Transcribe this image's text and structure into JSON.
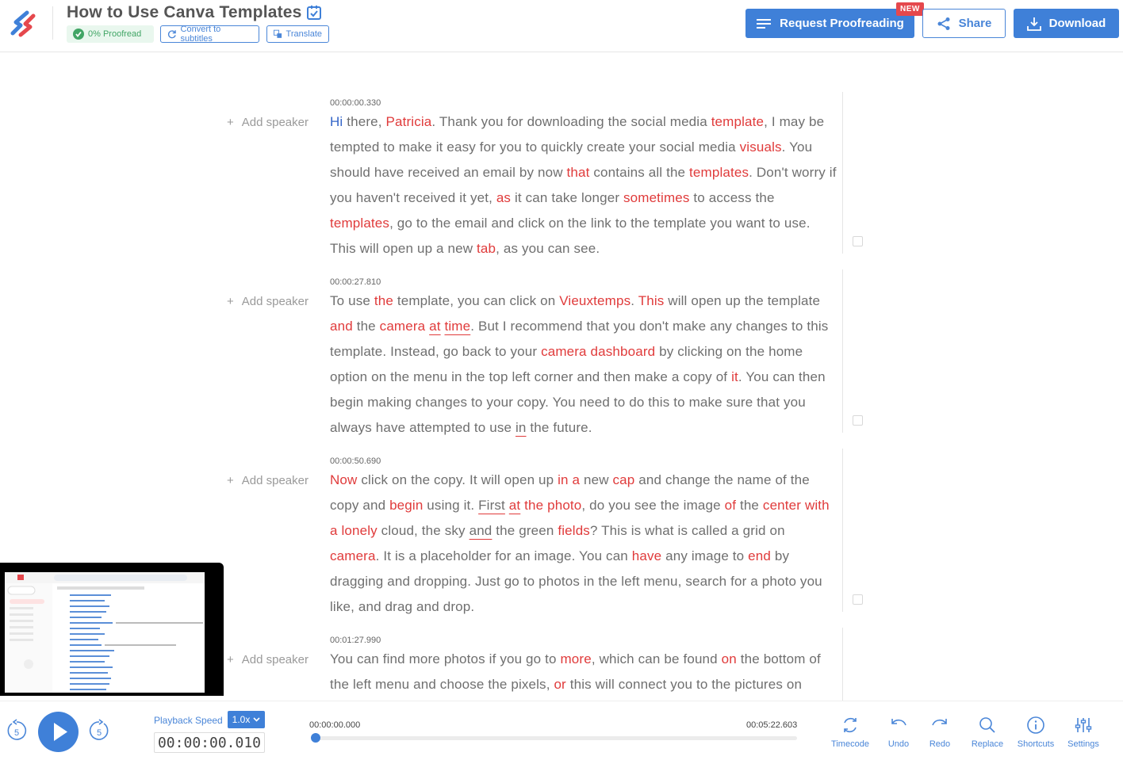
{
  "header": {
    "title": "How to Use Canva Templates",
    "proofread_label": "0% Proofread",
    "subtitles_label": "Convert to subtitles",
    "translate_label": "Translate",
    "request_label": "Request Proofreading",
    "new_badge": "NEW",
    "share_label": "Share",
    "download_label": "Download",
    "accent_color": "#3f80d8"
  },
  "transcript": {
    "add_speaker_label": "Add speaker",
    "paragraphs": [
      {
        "timecode": "00:00:00.330",
        "segments": [
          {
            "t": "Hi",
            "s": "b"
          },
          {
            "t": " there, "
          },
          {
            "t": "Patricia",
            "s": "r"
          },
          {
            "t": ". Thank you for downloading the social media "
          },
          {
            "t": "template",
            "s": "r"
          },
          {
            "t": ", I may be tempted to make it easy for you to quickly create your social media "
          },
          {
            "t": "visuals",
            "s": "r"
          },
          {
            "t": ". You should have received an email by now "
          },
          {
            "t": "that",
            "s": "r"
          },
          {
            "t": " contains all the "
          },
          {
            "t": "templates",
            "s": "r"
          },
          {
            "t": ". Don't worry if you haven't received it yet, "
          },
          {
            "t": "as",
            "s": "r"
          },
          {
            "t": " it can take longer "
          },
          {
            "t": "sometimes",
            "s": "r"
          },
          {
            "t": " to access the "
          },
          {
            "t": "templates",
            "s": "r"
          },
          {
            "t": ", go to the email and click on the link to the template you want to use. This will open up a new "
          },
          {
            "t": "tab",
            "s": "r"
          },
          {
            "t": ", as you can see."
          }
        ]
      },
      {
        "timecode": "00:00:27.810",
        "segments": [
          {
            "t": "To use "
          },
          {
            "t": "the",
            "s": "r"
          },
          {
            "t": " template, you can click on "
          },
          {
            "t": "Vieuxtemps",
            "s": "r"
          },
          {
            "t": ". "
          },
          {
            "t": "This",
            "s": "r"
          },
          {
            "t": " will open up the template "
          },
          {
            "t": "and",
            "s": "r"
          },
          {
            "t": " the "
          },
          {
            "t": "camera",
            "s": "r"
          },
          {
            "t": " "
          },
          {
            "t": "at",
            "s": "ru"
          },
          {
            "t": " "
          },
          {
            "t": "time",
            "s": "ru"
          },
          {
            "t": ". But I recommend that you don't make any changes to this template. Instead, go back to your "
          },
          {
            "t": "camera dashboard",
            "s": "r"
          },
          {
            "t": " by clicking on the home option on the menu in the top left corner and then make a copy of "
          },
          {
            "t": "it",
            "s": "r"
          },
          {
            "t": ". You can then begin making changes to your copy. You need to do this to make sure that you always have attempted to use "
          },
          {
            "t": "in",
            "s": "u"
          },
          {
            "t": " the future."
          }
        ]
      },
      {
        "timecode": "00:00:50.690",
        "segments": [
          {
            "t": "Now",
            "s": "r"
          },
          {
            "t": " click on the copy. It will open up "
          },
          {
            "t": "in a",
            "s": "r"
          },
          {
            "t": " new "
          },
          {
            "t": "cap",
            "s": "r"
          },
          {
            "t": " and change the name of the copy and "
          },
          {
            "t": "begin",
            "s": "r"
          },
          {
            "t": " using it. "
          },
          {
            "t": "First",
            "s": "u"
          },
          {
            "t": " "
          },
          {
            "t": "at",
            "s": "ru"
          },
          {
            "t": " "
          },
          {
            "t": "the photo",
            "s": "r"
          },
          {
            "t": ", do you see the image "
          },
          {
            "t": "of",
            "s": "r"
          },
          {
            "t": " the "
          },
          {
            "t": "center with a lonely",
            "s": "r"
          },
          {
            "t": " cloud, the sky "
          },
          {
            "t": "and",
            "s": "u"
          },
          {
            "t": " the green "
          },
          {
            "t": "fields",
            "s": "r"
          },
          {
            "t": "? This is what is called a grid on "
          },
          {
            "t": "camera",
            "s": "r"
          },
          {
            "t": ". It is a placeholder for an image. You can "
          },
          {
            "t": "have",
            "s": "r"
          },
          {
            "t": " any image to "
          },
          {
            "t": "end",
            "s": "r"
          },
          {
            "t": " by dragging and dropping. Just go to photos in the left menu, search for a photo you like, and drag and drop."
          }
        ]
      },
      {
        "timecode": "00:01:27.990",
        "segments": [
          {
            "t": "You can find more photos if you go to "
          },
          {
            "t": "more",
            "s": "r"
          },
          {
            "t": ", which can be found "
          },
          {
            "t": "on",
            "s": "r"
          },
          {
            "t": " the bottom of the left menu and choose the pixels, "
          },
          {
            "t": "or",
            "s": "r"
          },
          {
            "t": " this will connect you to the pictures on"
          }
        ]
      }
    ]
  },
  "player": {
    "playback_speed_label": "Playback Speed",
    "speed_value": "1.0x",
    "current_time": "00:00:00.010",
    "start_time": "00:00:00.000",
    "end_time": "00:05:22.603",
    "progress_fraction": 0.0,
    "skip_seconds": "5",
    "tools": {
      "timecode": "Timecode",
      "undo": "Undo",
      "redo": "Redo",
      "replace": "Replace",
      "shortcuts": "Shortcuts",
      "settings": "Settings"
    }
  }
}
